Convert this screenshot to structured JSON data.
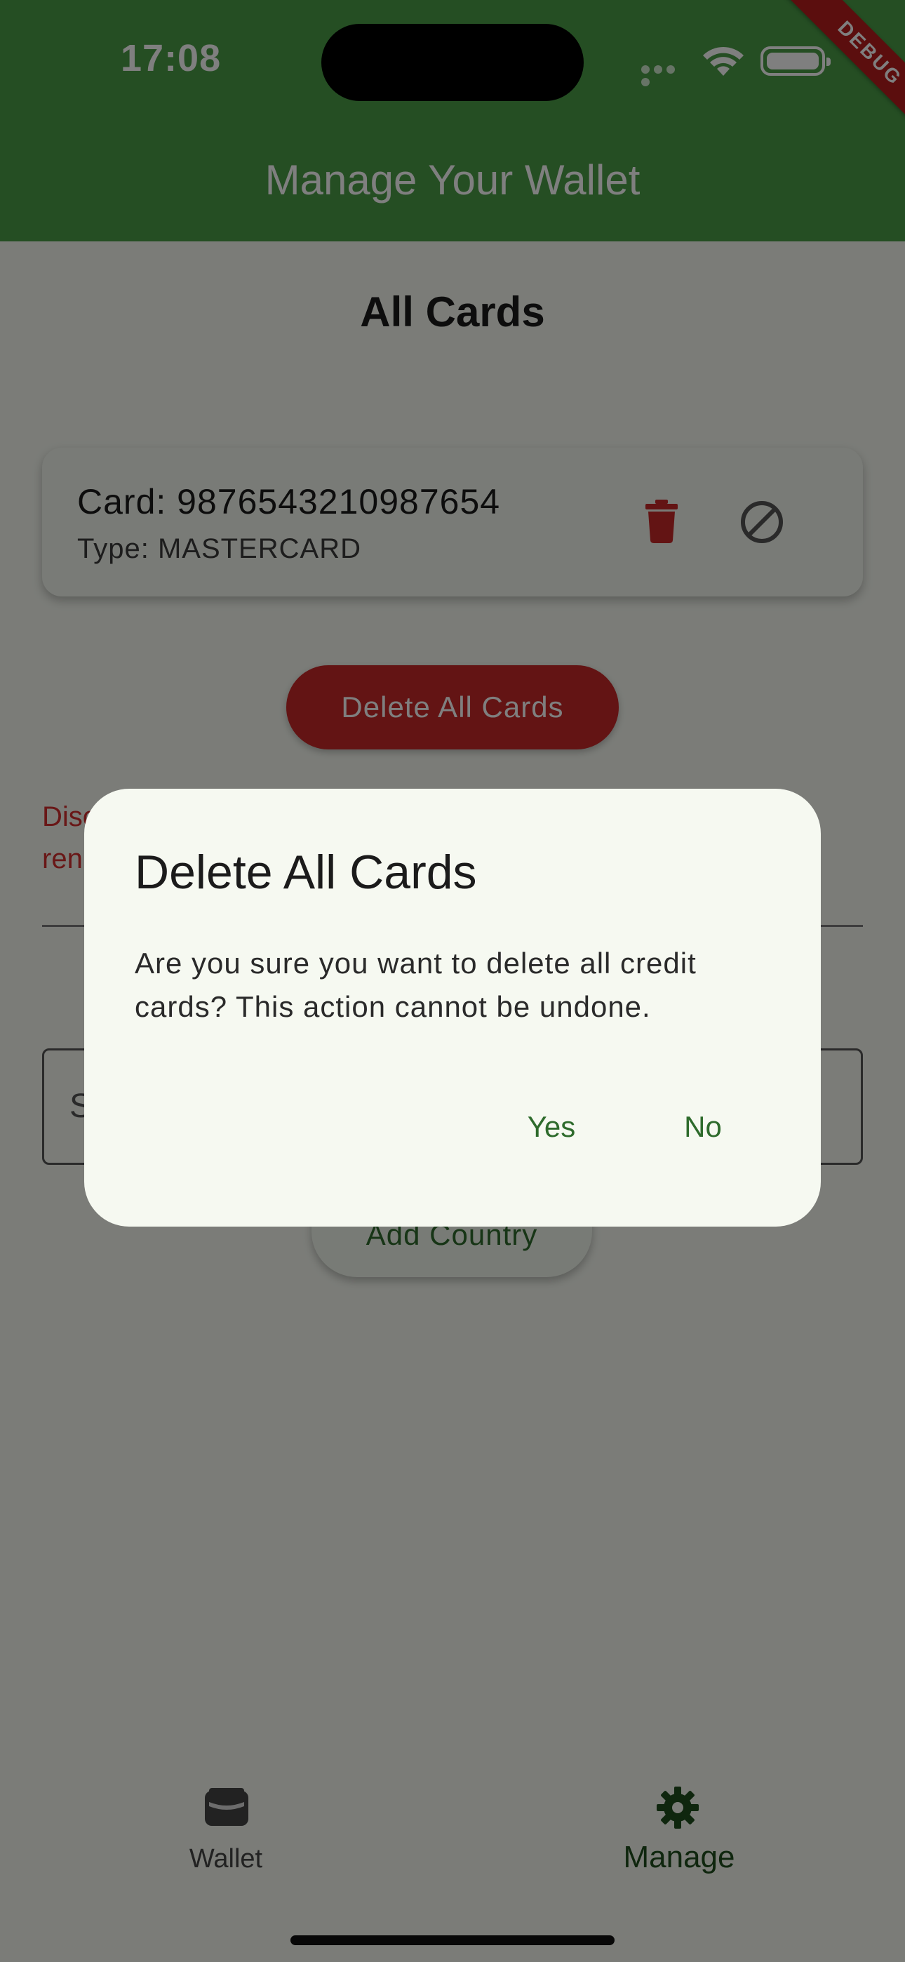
{
  "status_bar": {
    "time": "17:08"
  },
  "debug_banner": "DEBUG",
  "app_bar": {
    "title": "Manage Your Wallet"
  },
  "main": {
    "section_title": "All Cards",
    "cards": [
      {
        "number_label": "Card: 9876543210987654",
        "type_label": "Type: MASTERCARD"
      }
    ],
    "delete_all_button": "Delete All Cards",
    "disclaimer_fragment": "Disc ren",
    "search_placeholder": "S",
    "add_country_button": "Add Country"
  },
  "bottom_nav": {
    "items": [
      {
        "label": "Wallet",
        "icon": "wallet-icon",
        "selected": false
      },
      {
        "label": "Manage",
        "icon": "gear-icon",
        "selected": true
      }
    ]
  },
  "dialog": {
    "title": "Delete All Cards",
    "message": "Are you sure you want to delete all credit cards? This action cannot be undone.",
    "yes_label": "Yes",
    "no_label": "No"
  },
  "colors": {
    "app_bar": "#4a9c47",
    "danger": "#c62828",
    "accent_text": "#2e6b2c",
    "dialog_bg": "#f6f9f1"
  }
}
